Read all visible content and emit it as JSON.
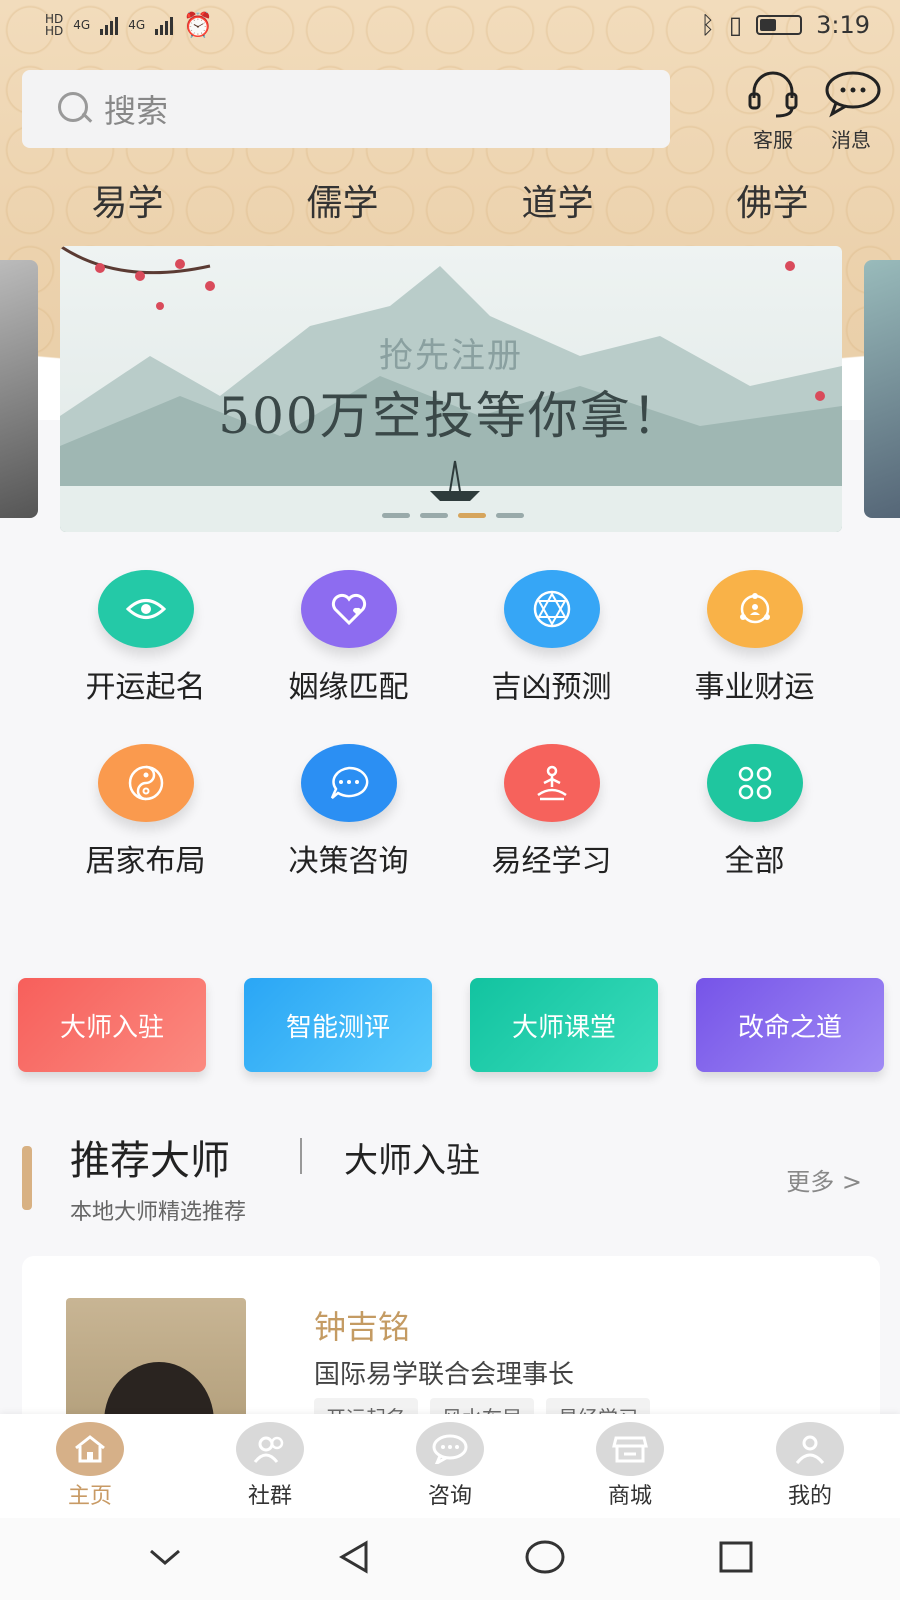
{
  "status_bar": {
    "time": "3:19",
    "net1": "4G",
    "net2": "4G"
  },
  "header": {
    "search_placeholder": "搜索",
    "service_label": "客服",
    "message_label": "消息"
  },
  "category_tabs": [
    "易学",
    "儒学",
    "道学",
    "佛学"
  ],
  "banner": {
    "small_text": "抢先注册",
    "big_text": "500万空投等你拿！",
    "active_dot": 2,
    "dot_count": 4
  },
  "features": [
    {
      "label": "开运起名",
      "icon": "eye-icon",
      "color": "#24c9a7"
    },
    {
      "label": "姻缘匹配",
      "icon": "heart-icon",
      "color": "#8d6cf0"
    },
    {
      "label": "吉凶预测",
      "icon": "hexagram-icon",
      "color": "#36a6f6"
    },
    {
      "label": "事业财运",
      "icon": "career-icon",
      "color": "#f9b248"
    },
    {
      "label": "居家布局",
      "icon": "yinyang-icon",
      "color": "#fa9a4e"
    },
    {
      "label": "决策咨询",
      "icon": "chat-icon",
      "color": "#2b8ff3"
    },
    {
      "label": "易经学习",
      "icon": "meditation-icon",
      "color": "#f6625c"
    },
    {
      "label": "全部",
      "icon": "grid-icon",
      "color": "#1fc69f"
    }
  ],
  "quick_buttons": [
    {
      "label": "大师入驻",
      "color": "#f46b66"
    },
    {
      "label": "智能测评",
      "color": "#34b4f7"
    },
    {
      "label": "大师课堂",
      "color": "#1fcdaa"
    },
    {
      "label": "改命之道",
      "color": "#8462ec"
    }
  ],
  "recommend": {
    "title": "推荐大师",
    "tab": "大师入驻",
    "subtitle": "本地大师精选推荐",
    "more": "更多 >"
  },
  "master": {
    "name": "钟吉铭",
    "title": "国际易学联合会理事长",
    "tags": [
      "开运起名",
      "风水布局",
      "易经学习"
    ]
  },
  "bottom_nav": [
    {
      "label": "主页",
      "icon": "home-icon",
      "active": true
    },
    {
      "label": "社群",
      "icon": "community-icon",
      "active": false
    },
    {
      "label": "咨询",
      "icon": "consult-icon",
      "active": false
    },
    {
      "label": "商城",
      "icon": "shop-icon",
      "active": false
    },
    {
      "label": "我的",
      "icon": "profile-icon",
      "active": false
    }
  ]
}
